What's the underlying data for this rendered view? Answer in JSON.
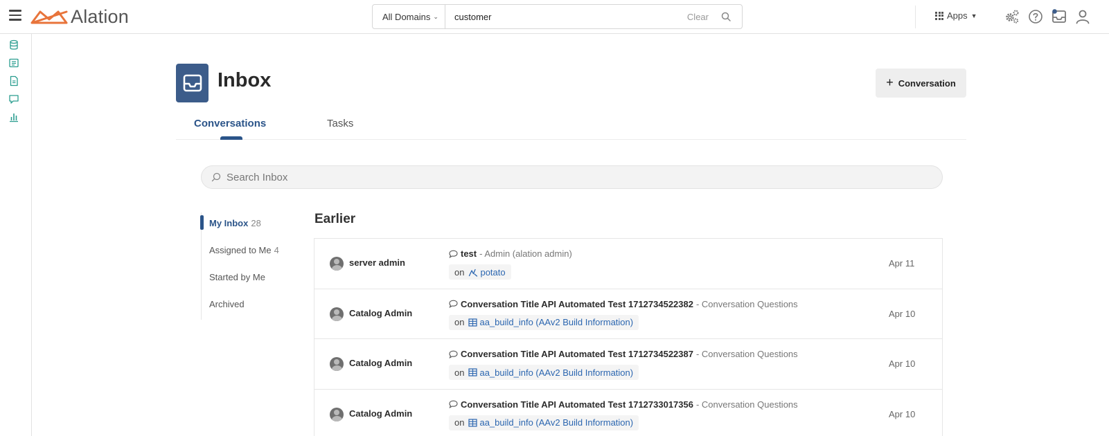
{
  "header": {
    "brand": "Alation",
    "search": {
      "domain_label": "All Domains",
      "query": "customer",
      "clear_label": "Clear"
    },
    "apps_label": "Apps"
  },
  "page": {
    "title": "Inbox",
    "new_button_label": "Conversation",
    "tabs": [
      {
        "label": "Conversations",
        "active": true
      },
      {
        "label": "Tasks",
        "active": false
      }
    ],
    "search_placeholder": "Search Inbox"
  },
  "filters": [
    {
      "label": "My Inbox",
      "count": "28",
      "active": true
    },
    {
      "label": "Assigned to Me",
      "count": "4",
      "active": false
    },
    {
      "label": "Started by Me",
      "count": "",
      "active": false
    },
    {
      "label": "Archived",
      "count": "",
      "active": false
    }
  ],
  "section_title": "Earlier",
  "conversations": [
    {
      "author": "server admin",
      "title": "test",
      "subtitle": "- Admin (alation admin)",
      "on_label": "on",
      "object_icon": "query-icon",
      "object_name": "potato",
      "date": "Apr 11"
    },
    {
      "author": "Catalog Admin",
      "title": "Conversation Title API Automated Test 1712734522382",
      "subtitle": "- Conversation Questions",
      "on_label": "on",
      "object_icon": "table-icon",
      "object_name": "aa_build_info (AAv2 Build Information)",
      "date": "Apr 10"
    },
    {
      "author": "Catalog Admin",
      "title": "Conversation Title API Automated Test 1712734522387",
      "subtitle": "- Conversation Questions",
      "on_label": "on",
      "object_icon": "table-icon",
      "object_name": "aa_build_info (AAv2 Build Information)",
      "date": "Apr 10"
    },
    {
      "author": "Catalog Admin",
      "title": "Conversation Title API Automated Test 1712733017356",
      "subtitle": "- Conversation Questions",
      "on_label": "on",
      "object_icon": "table-icon",
      "object_name": "aa_build_info (AAv2 Build Information)",
      "date": "Apr 10"
    }
  ],
  "colors": {
    "brand_orange": "#e8743b",
    "accent_blue": "#2b5489",
    "inbox_badge": "#3c5c8a",
    "rail_teal": "#2a9d8f",
    "link_blue": "#2b66b0"
  },
  "icons": {
    "rail": [
      "database-icon",
      "catalog-icon",
      "document-icon",
      "conversation-icon",
      "chart-icon"
    ],
    "top_right": [
      "settings-gears-icon",
      "help-icon",
      "inbox-icon",
      "user-icon"
    ]
  }
}
